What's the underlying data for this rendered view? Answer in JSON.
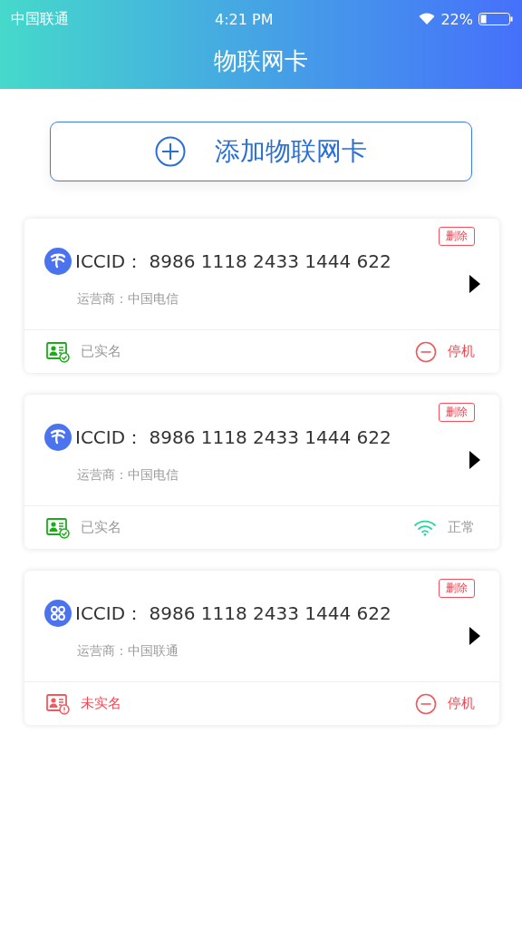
{
  "status_bar": {
    "carrier": "中国联通",
    "time": "4:21 PM",
    "battery": "22%"
  },
  "title": "物联网卡",
  "add_button": {
    "label": "添加物联网卡"
  },
  "cards": [
    {
      "kind": "telecom",
      "iccid_label": "ICCID：",
      "iccid": "8986 1118 2433 1444 622",
      "carrier_label": "运营商：",
      "carrier": "中国电信",
      "delete": "删除",
      "verified": true,
      "verify_text": "已实名",
      "status": {
        "kind": "stopped",
        "text": "停机"
      }
    },
    {
      "kind": "telecom",
      "iccid_label": "ICCID：",
      "iccid": "8986 1118 2433 1444 622",
      "carrier_label": "运营商：",
      "carrier": "中国电信",
      "delete": "删除",
      "verified": true,
      "verify_text": "已实名",
      "status": {
        "kind": "normal",
        "text": "正常"
      }
    },
    {
      "kind": "unicom",
      "iccid_label": "ICCID：",
      "iccid": "8986 1118 2433 1444 622",
      "carrier_label": "运营商：",
      "carrier": "中国联通",
      "delete": "删除",
      "verified": false,
      "verify_text": "未实名",
      "status": {
        "kind": "stopped",
        "text": "停机"
      }
    }
  ]
}
